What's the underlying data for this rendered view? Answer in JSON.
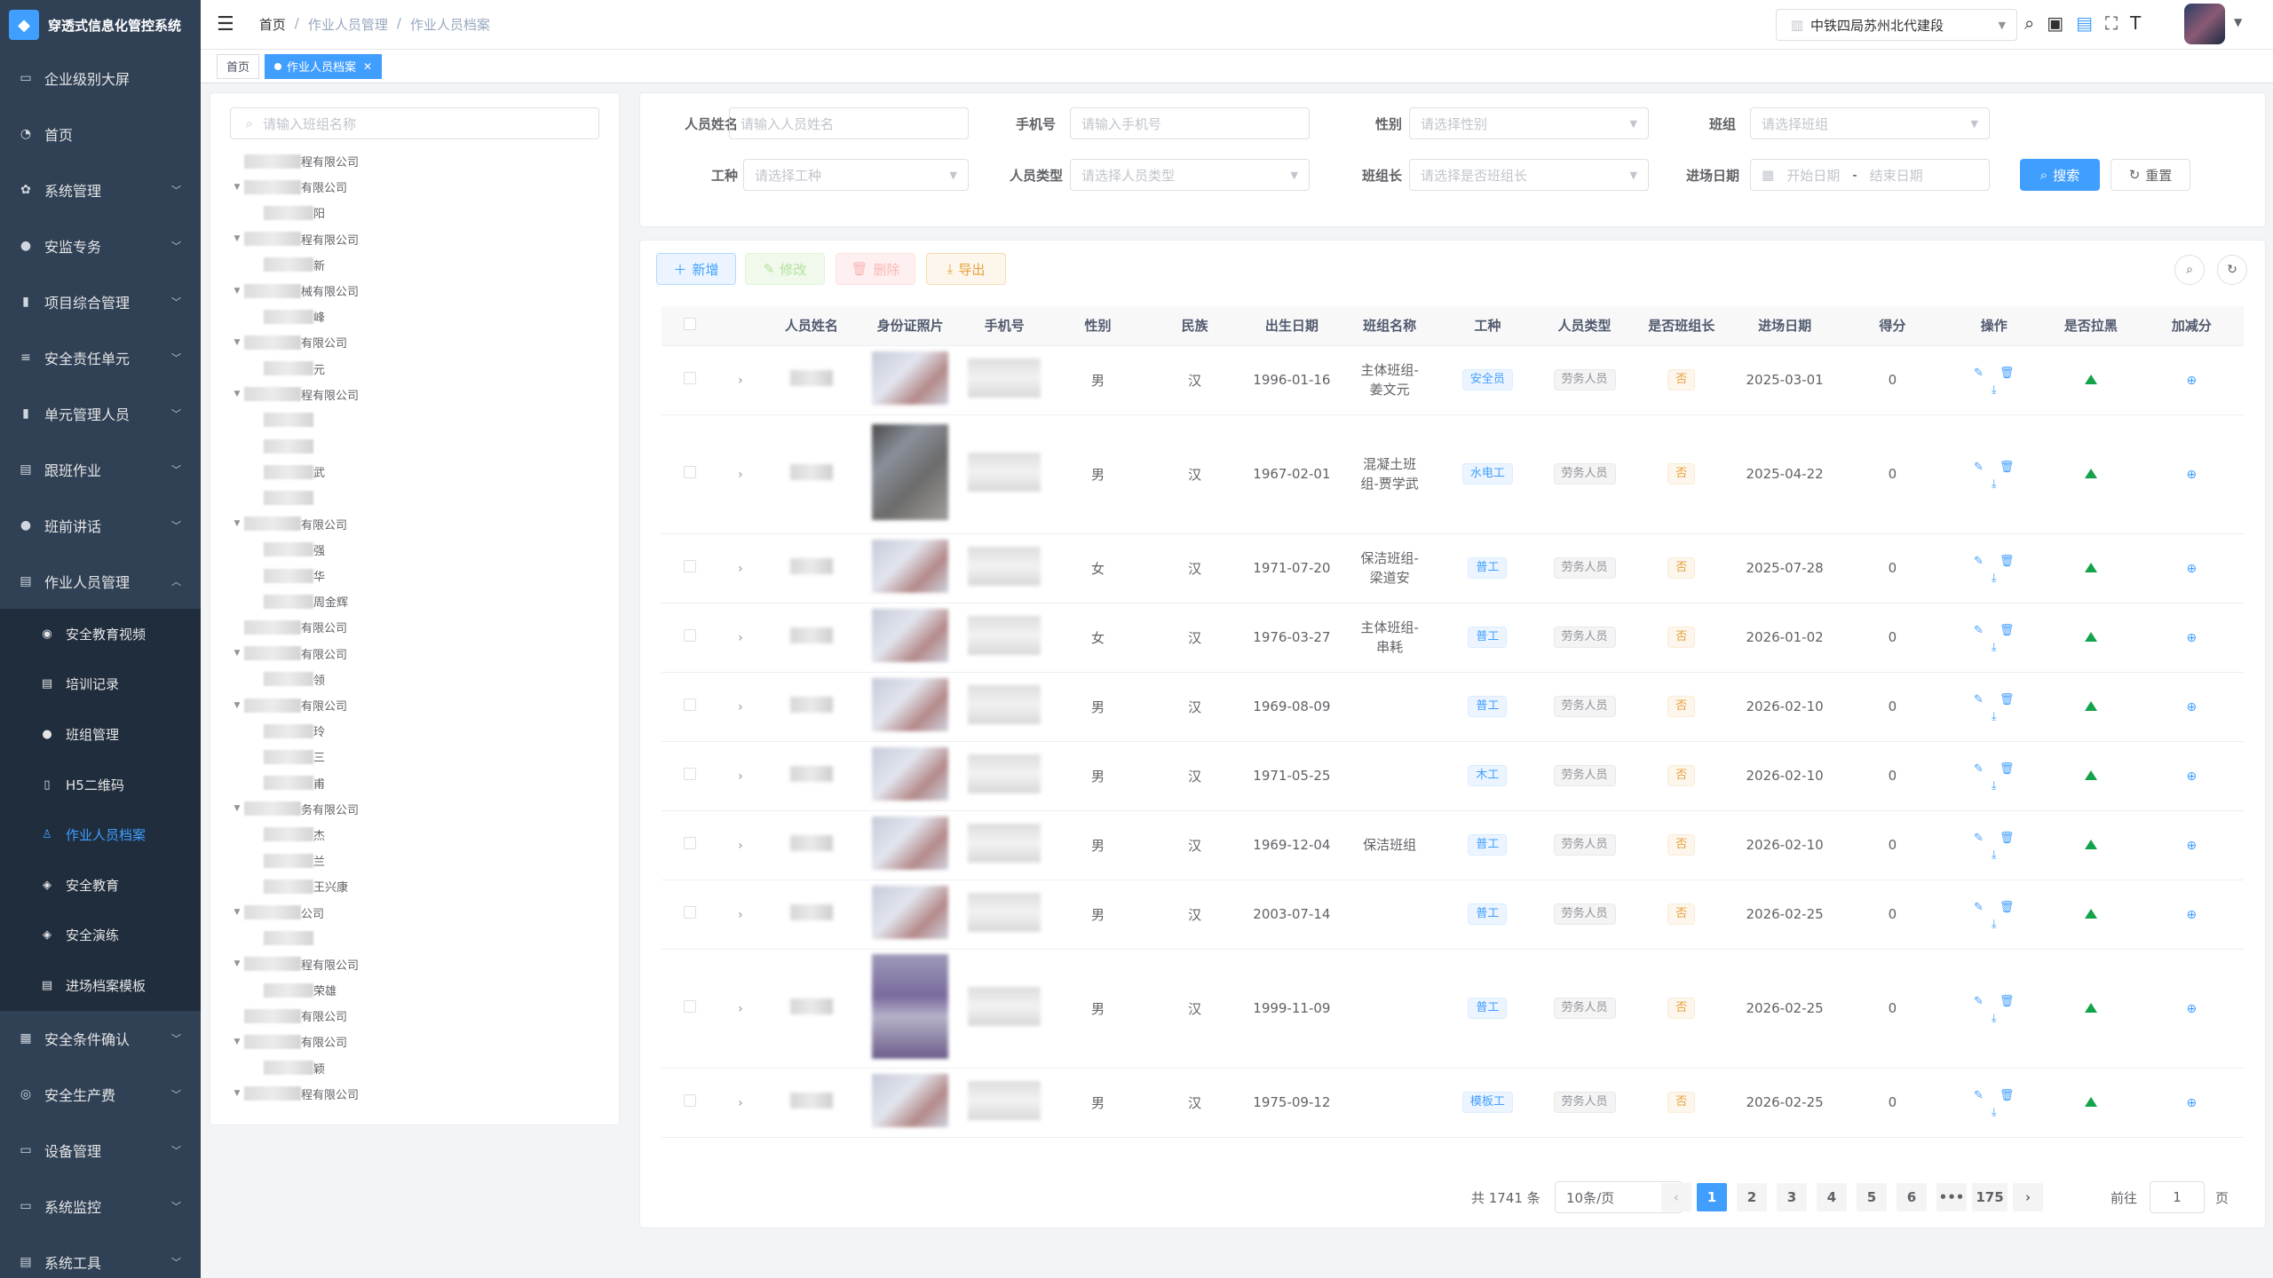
{
  "app": {
    "title": "穿透式信息化管控系统"
  },
  "sidebar": {
    "items": [
      {
        "label": "企业级别大屏",
        "icon": "monitor-icon",
        "glyph": "▭",
        "has_children": false
      },
      {
        "label": "首页",
        "icon": "dashboard-icon",
        "glyph": "◔",
        "has_children": false
      },
      {
        "label": "系统管理",
        "icon": "gear-icon",
        "glyph": "✿",
        "has_children": true
      },
      {
        "label": "安监专务",
        "icon": "user-icon",
        "glyph": "●",
        "has_children": true
      },
      {
        "label": "项目综合管理",
        "icon": "bar-chart-icon",
        "glyph": "▮",
        "has_children": true
      },
      {
        "label": "安全责任单元",
        "icon": "list-icon",
        "glyph": "≡",
        "has_children": true
      },
      {
        "label": "单元管理人员",
        "icon": "bar-chart-icon",
        "glyph": "▮",
        "has_children": true
      },
      {
        "label": "跟班作业",
        "icon": "document-icon",
        "glyph": "▤",
        "has_children": true
      },
      {
        "label": "班前讲话",
        "icon": "people-icon",
        "glyph": "●",
        "has_children": true
      },
      {
        "label": "作业人员管理",
        "icon": "document-icon",
        "glyph": "▤",
        "has_children": true,
        "expanded": true
      }
    ],
    "sub_items": [
      {
        "label": "安全教育视频",
        "icon": "video-icon",
        "glyph": "◉"
      },
      {
        "label": "培训记录",
        "icon": "document-icon",
        "glyph": "▤"
      },
      {
        "label": "班组管理",
        "icon": "people-icon",
        "glyph": "●"
      },
      {
        "label": "H5二维码",
        "icon": "phone-icon",
        "glyph": "▯"
      },
      {
        "label": "作业人员档案",
        "icon": "user-icon",
        "glyph": "♙",
        "active": true
      },
      {
        "label": "安全教育",
        "icon": "shield-icon",
        "glyph": "◈"
      },
      {
        "label": "安全演练",
        "icon": "shield-icon",
        "glyph": "◈"
      },
      {
        "label": "进场档案模板",
        "icon": "document-icon",
        "glyph": "▤"
      }
    ],
    "bottom_items": [
      {
        "label": "安全条件确认",
        "icon": "grid-icon",
        "glyph": "▦",
        "has_children": true
      },
      {
        "label": "安全生产费",
        "icon": "money-icon",
        "glyph": "◎",
        "has_children": true
      },
      {
        "label": "设备管理",
        "icon": "device-icon",
        "glyph": "▭",
        "has_children": true
      },
      {
        "label": "系统监控",
        "icon": "monitor-icon",
        "glyph": "▭",
        "has_children": true
      },
      {
        "label": "系统工具",
        "icon": "document-icon",
        "glyph": "▤",
        "has_children": true
      }
    ]
  },
  "header": {
    "breadcrumb": [
      "首页",
      "作业人员管理",
      "作业人员档案"
    ],
    "separator": "/",
    "org_select": "中铁四局苏州北代建段"
  },
  "tabs": [
    {
      "label": "首页",
      "active": false
    },
    {
      "label": "作业人员档案",
      "active": true
    }
  ],
  "tree": {
    "search_placeholder": "请输入班组名称",
    "nodes": [
      {
        "suffix": "程有限公司",
        "level": 0,
        "arrow": false
      },
      {
        "suffix": "有限公司",
        "level": 0,
        "arrow": true
      },
      {
        "suffix": "阳",
        "level": 1,
        "arrow": false
      },
      {
        "suffix": "程有限公司",
        "level": 0,
        "arrow": true
      },
      {
        "suffix": "新",
        "level": 1,
        "arrow": false
      },
      {
        "suffix": "械有限公司",
        "level": 0,
        "arrow": true
      },
      {
        "suffix": "峰",
        "level": 1,
        "arrow": false
      },
      {
        "suffix": "有限公司",
        "level": 0,
        "arrow": true
      },
      {
        "suffix": "元",
        "level": 1,
        "arrow": false
      },
      {
        "suffix": "程有限公司",
        "level": 0,
        "arrow": true
      },
      {
        "suffix": "",
        "level": 1,
        "arrow": false
      },
      {
        "suffix": "",
        "level": 1,
        "arrow": false
      },
      {
        "suffix": "武",
        "level": 1,
        "arrow": false
      },
      {
        "suffix": "",
        "level": 1,
        "arrow": false
      },
      {
        "suffix": "有限公司",
        "level": 0,
        "arrow": true
      },
      {
        "suffix": "强",
        "level": 1,
        "arrow": false
      },
      {
        "suffix": "华",
        "level": 1,
        "arrow": false
      },
      {
        "suffix": "周金辉",
        "level": 1,
        "arrow": false
      },
      {
        "suffix": "有限公司",
        "level": 0,
        "arrow": false
      },
      {
        "suffix": "有限公司",
        "level": 0,
        "arrow": true
      },
      {
        "suffix": "领",
        "level": 1,
        "arrow": false
      },
      {
        "suffix": "有限公司",
        "level": 0,
        "arrow": true
      },
      {
        "suffix": "玲",
        "level": 1,
        "arrow": false
      },
      {
        "suffix": "三",
        "level": 1,
        "arrow": false
      },
      {
        "suffix": "甫",
        "level": 1,
        "arrow": false
      },
      {
        "suffix": "务有限公司",
        "level": 0,
        "arrow": true
      },
      {
        "suffix": "杰",
        "level": 1,
        "arrow": false
      },
      {
        "suffix": "兰",
        "level": 1,
        "arrow": false
      },
      {
        "suffix": "王兴康",
        "level": 1,
        "arrow": false
      },
      {
        "suffix": "公司",
        "level": 0,
        "arrow": true
      },
      {
        "suffix": "",
        "level": 1,
        "arrow": false
      },
      {
        "suffix": "程有限公司",
        "level": 0,
        "arrow": true
      },
      {
        "suffix": "荣雄",
        "level": 1,
        "arrow": false
      },
      {
        "suffix": "有限公司",
        "level": 0,
        "arrow": false
      },
      {
        "suffix": "有限公司",
        "level": 0,
        "arrow": true
      },
      {
        "suffix": "颖",
        "level": 1,
        "arrow": false
      },
      {
        "suffix": "程有限公司",
        "level": 0,
        "arrow": true
      }
    ]
  },
  "filters": {
    "name_label": "人员姓名",
    "name_placeholder": "请输入人员姓名",
    "phone_label": "手机号",
    "phone_placeholder": "请输入手机号",
    "gender_label": "性别",
    "gender_placeholder": "请选择性别",
    "team_label": "班组",
    "team_placeholder": "请选择班组",
    "trade_label": "工种",
    "trade_placeholder": "请选择工种",
    "type_label": "人员类型",
    "type_placeholder": "请选择人员类型",
    "leader_label": "班组长",
    "leader_placeholder": "请选择是否班组长",
    "date_label": "进场日期",
    "date_start": "开始日期",
    "date_sep": "-",
    "date_end": "结束日期",
    "search_btn": "搜索",
    "reset_btn": "重置"
  },
  "toolbar": {
    "add": "新增",
    "edit": "修改",
    "delete": "删除",
    "export": "导出"
  },
  "table": {
    "columns": [
      "人员姓名",
      "身份证照片",
      "手机号",
      "性别",
      "民族",
      "出生日期",
      "班组名称",
      "工种",
      "人员类型",
      "是否班组长",
      "进场日期",
      "得分",
      "操作",
      "是否拉黑",
      "加减分"
    ],
    "rows": [
      {
        "gender": "男",
        "ethnic": "汉",
        "birth": "1996-01-16",
        "team": "主体班组-姜文元",
        "trade": "安全员",
        "type": "劳务人员",
        "leader": "否",
        "entry": "2025-03-01",
        "score": "0",
        "photo": "normal"
      },
      {
        "gender": "男",
        "ethnic": "汉",
        "birth": "1967-02-01",
        "team": "混凝土班组-贾学武",
        "trade": "水电工",
        "type": "劳务人员",
        "leader": "否",
        "entry": "2025-04-22",
        "score": "0",
        "photo": "tall"
      },
      {
        "gender": "女",
        "ethnic": "汉",
        "birth": "1971-07-20",
        "team": "保洁班组-梁道安",
        "trade": "普工",
        "type": "劳务人员",
        "leader": "否",
        "entry": "2025-07-28",
        "score": "0",
        "photo": "normal"
      },
      {
        "gender": "女",
        "ethnic": "汉",
        "birth": "1976-03-27",
        "team": "主体班组-串耗",
        "trade": "普工",
        "type": "劳务人员",
        "leader": "否",
        "entry": "2026-01-02",
        "score": "0",
        "photo": "normal"
      },
      {
        "gender": "男",
        "ethnic": "汉",
        "birth": "1969-08-09",
        "team": "",
        "trade": "普工",
        "type": "劳务人员",
        "leader": "否",
        "entry": "2026-02-10",
        "score": "0",
        "photo": "normal"
      },
      {
        "gender": "男",
        "ethnic": "汉",
        "birth": "1971-05-25",
        "team": "",
        "trade": "木工",
        "type": "劳务人员",
        "leader": "否",
        "entry": "2026-02-10",
        "score": "0",
        "photo": "normal"
      },
      {
        "gender": "男",
        "ethnic": "汉",
        "birth": "1969-12-04",
        "team": "保洁班组",
        "trade": "普工",
        "type": "劳务人员",
        "leader": "否",
        "entry": "2026-02-10",
        "score": "0",
        "photo": "normal"
      },
      {
        "gender": "男",
        "ethnic": "汉",
        "birth": "2003-07-14",
        "team": "",
        "trade": "普工",
        "type": "劳务人员",
        "leader": "否",
        "entry": "2026-02-25",
        "score": "0",
        "photo": "normal"
      },
      {
        "gender": "男",
        "ethnic": "汉",
        "birth": "1999-11-09",
        "team": "",
        "trade": "普工",
        "type": "劳务人员",
        "leader": "否",
        "entry": "2026-02-25",
        "score": "0",
        "photo": "tall2"
      },
      {
        "gender": "男",
        "ethnic": "汉",
        "birth": "1975-09-12",
        "team": "",
        "trade": "模板工",
        "type": "劳务人员",
        "leader": "否",
        "entry": "2026-02-25",
        "score": "0",
        "photo": "normal"
      }
    ]
  },
  "pagination": {
    "total": "共 1741 条",
    "page_size": "10条/页",
    "pages": [
      "1",
      "2",
      "3",
      "4",
      "5",
      "6",
      "•••",
      "175"
    ],
    "current": "1",
    "goto_label": "前往",
    "goto_value": "1",
    "page_suffix": "页"
  },
  "colors": {
    "primary": "#409eff",
    "sidebar_bg": "#304156",
    "submenu_bg": "#1f2d3d",
    "blacklist_green": "#13a34b"
  }
}
